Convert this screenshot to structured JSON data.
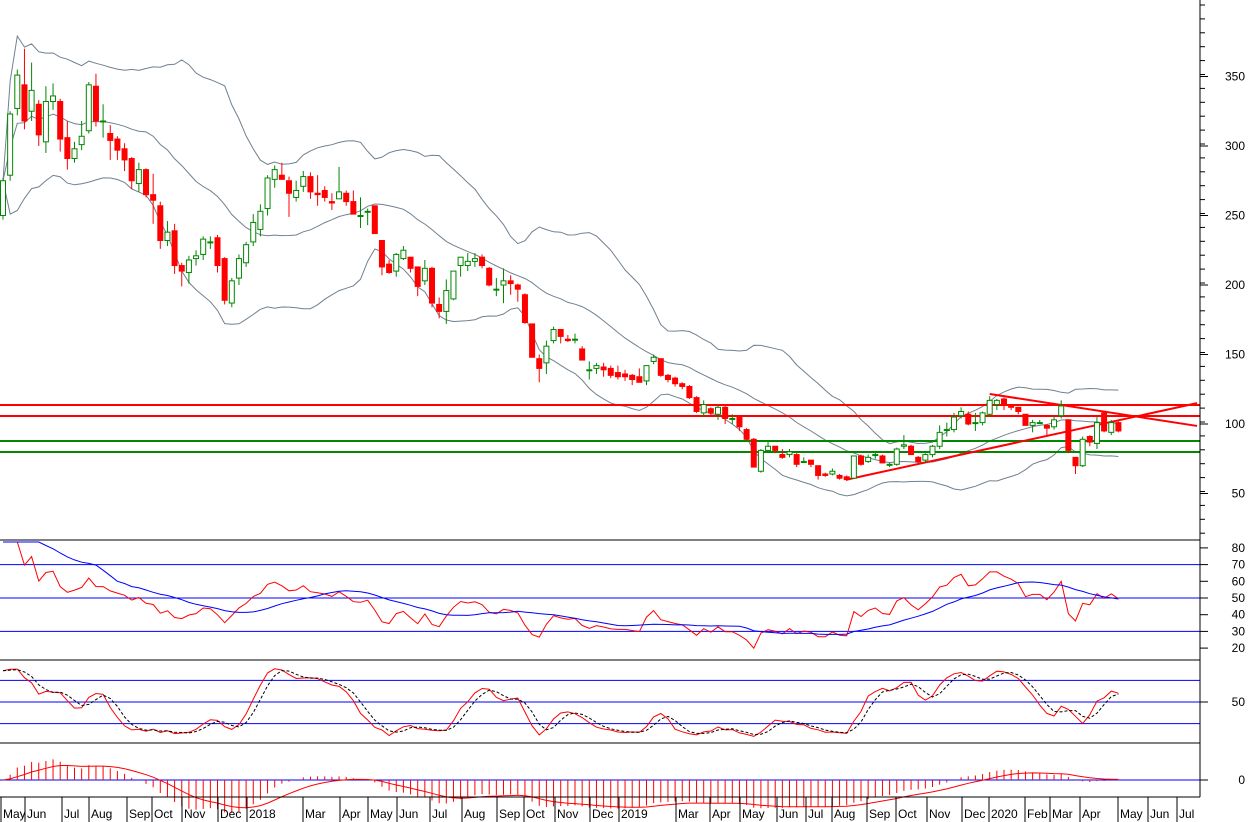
{
  "chart_data": {
    "type": "candlestick",
    "title": "",
    "colors": {
      "up": "#008800",
      "down": "#ff0000",
      "bands": "#708090",
      "rsi": "#ff0000",
      "rsi_ma": "#0000ff",
      "stoch_k": "#ff0000",
      "stoch_d": "#000000",
      "macd_hist": "#ff0000",
      "level_lines": "#0000ff",
      "resistance": "#ff0000",
      "support": "#008800"
    },
    "price_axis": {
      "ticks": [
        50,
        100,
        150,
        200,
        250,
        300,
        350
      ],
      "range": [
        20,
        400
      ]
    },
    "x_tick_labels": [
      "May",
      "Jun",
      "Jul",
      "Aug",
      "Sep",
      "Oct",
      "Nov",
      "Dec",
      "2018",
      "Mar",
      "Apr",
      "May",
      "Jun",
      "Jul",
      "Aug",
      "Sep",
      "Oct",
      "Nov",
      "Dec",
      "2019",
      "Mar",
      "Apr",
      "May",
      "Jun",
      "Jul",
      "Aug",
      "Sep",
      "Oct",
      "Nov",
      "Dec",
      "2020",
      "Feb",
      "Mar",
      "Apr",
      "May",
      "Jun",
      "Jul"
    ],
    "ohlc": [
      [
        250,
        277,
        247,
        275
      ],
      [
        279,
        325,
        275,
        323
      ],
      [
        327,
        355,
        322,
        351
      ],
      [
        344,
        370,
        312,
        318
      ],
      [
        325,
        360,
        318,
        340
      ],
      [
        330,
        333,
        300,
        308
      ],
      [
        303,
        343,
        295,
        332
      ],
      [
        332,
        345,
        326,
        336
      ],
      [
        332,
        334,
        296,
        305
      ],
      [
        306,
        318,
        283,
        291
      ],
      [
        291,
        303,
        288,
        298
      ],
      [
        301,
        318,
        297,
        307
      ],
      [
        311,
        346,
        309,
        344
      ],
      [
        343,
        352,
        314,
        318
      ],
      [
        318,
        330,
        306,
        318
      ],
      [
        309,
        315,
        290,
        304
      ],
      [
        305,
        307,
        290,
        297
      ],
      [
        298,
        302,
        282,
        290
      ],
      [
        291,
        292,
        269,
        275
      ],
      [
        273,
        288,
        267,
        283
      ],
      [
        283,
        284,
        263,
        265
      ],
      [
        265,
        280,
        244,
        261
      ],
      [
        257,
        260,
        226,
        232
      ],
      [
        232,
        246,
        228,
        238
      ],
      [
        239,
        244,
        208,
        214
      ],
      [
        214,
        216,
        199,
        210
      ],
      [
        209,
        221,
        201,
        218
      ],
      [
        219,
        225,
        214,
        221
      ],
      [
        222,
        235,
        218,
        233
      ],
      [
        231,
        235,
        226,
        231
      ],
      [
        234,
        236,
        209,
        214
      ],
      [
        219,
        220,
        186,
        189
      ],
      [
        187,
        205,
        184,
        203
      ],
      [
        205,
        222,
        200,
        219
      ],
      [
        216,
        231,
        213,
        229
      ],
      [
        231,
        251,
        228,
        245
      ],
      [
        240,
        258,
        235,
        253
      ],
      [
        255,
        279,
        250,
        277
      ],
      [
        276,
        286,
        270,
        283
      ],
      [
        279,
        288,
        276,
        276
      ],
      [
        275,
        278,
        249,
        266
      ],
      [
        263,
        275,
        260,
        268
      ],
      [
        271,
        282,
        267,
        278
      ],
      [
        278,
        281,
        262,
        267
      ],
      [
        266,
        279,
        257,
        265
      ],
      [
        268,
        271,
        260,
        263
      ],
      [
        260,
        266,
        254,
        259
      ],
      [
        262,
        285,
        262,
        267
      ],
      [
        266,
        268,
        257,
        260
      ],
      [
        260,
        268,
        251,
        251
      ],
      [
        250,
        263,
        241,
        250
      ],
      [
        253,
        255,
        243,
        253
      ],
      [
        257,
        257,
        237,
        237
      ],
      [
        232,
        232,
        207,
        213
      ],
      [
        215,
        218,
        208,
        209
      ],
      [
        210,
        223,
        206,
        222
      ],
      [
        219,
        228,
        218,
        225
      ],
      [
        220,
        220,
        209,
        212
      ],
      [
        213,
        213,
        192,
        199
      ],
      [
        203,
        218,
        200,
        212
      ],
      [
        212,
        213,
        184,
        187
      ],
      [
        186,
        191,
        176,
        181
      ],
      [
        181,
        204,
        172,
        196
      ],
      [
        190,
        210,
        189,
        210
      ],
      [
        214,
        220,
        206,
        220
      ],
      [
        214,
        223,
        210,
        217
      ],
      [
        217,
        223,
        213,
        219
      ],
      [
        220,
        222,
        212,
        214
      ],
      [
        212,
        213,
        199,
        200
      ],
      [
        197,
        205,
        192,
        197
      ],
      [
        200,
        212,
        187,
        203
      ],
      [
        203,
        207,
        193,
        201
      ],
      [
        200,
        201,
        188,
        197
      ],
      [
        193,
        194,
        172,
        173
      ],
      [
        172,
        172,
        148,
        148
      ],
      [
        147,
        150,
        130,
        140
      ],
      [
        144,
        160,
        136,
        156
      ],
      [
        160,
        170,
        158,
        168
      ],
      [
        168,
        168,
        158,
        163
      ],
      [
        161,
        164,
        159,
        160
      ],
      [
        161,
        165,
        158,
        161
      ],
      [
        154,
        156,
        146,
        146
      ],
      [
        139,
        145,
        132,
        139
      ],
      [
        140,
        144,
        136,
        142
      ],
      [
        141,
        144,
        134,
        139
      ],
      [
        140,
        142,
        133,
        135
      ],
      [
        137,
        142,
        132,
        134
      ],
      [
        136,
        139,
        131,
        134
      ],
      [
        135,
        136,
        128,
        132
      ],
      [
        134,
        140,
        130,
        130
      ],
      [
        131,
        142,
        128,
        142
      ],
      [
        145,
        150,
        143,
        148
      ],
      [
        147,
        147,
        134,
        135
      ],
      [
        135,
        136,
        130,
        132
      ],
      [
        133,
        134,
        127,
        129
      ],
      [
        129,
        130,
        125,
        127
      ],
      [
        127,
        128,
        118,
        119
      ],
      [
        119,
        120,
        108,
        109
      ],
      [
        108,
        117,
        105,
        114
      ],
      [
        111,
        112,
        106,
        108
      ],
      [
        107,
        113,
        103,
        112
      ],
      [
        112,
        114,
        100,
        104
      ],
      [
        104,
        107,
        100,
        104
      ],
      [
        105,
        106,
        95,
        98
      ],
      [
        96,
        97,
        88,
        89
      ],
      [
        89,
        90,
        69,
        69
      ],
      [
        66,
        82,
        65,
        81
      ],
      [
        81,
        87,
        80,
        84
      ],
      [
        84,
        84,
        79,
        81
      ],
      [
        78,
        82,
        75,
        76
      ],
      [
        78,
        82,
        76,
        80
      ],
      [
        78,
        79,
        69,
        71
      ],
      [
        73,
        76,
        72,
        73
      ],
      [
        74,
        74,
        69,
        71
      ],
      [
        70,
        70,
        60,
        63
      ],
      [
        64,
        65,
        62,
        63
      ],
      [
        64,
        68,
        63,
        66
      ],
      [
        63,
        64,
        60,
        61
      ],
      [
        62,
        63,
        59,
        60
      ],
      [
        61,
        77,
        61,
        77
      ],
      [
        77,
        78,
        70,
        71
      ],
      [
        73,
        78,
        72,
        76
      ],
      [
        78,
        80,
        75,
        78
      ],
      [
        77,
        78,
        72,
        72
      ],
      [
        71,
        72,
        69,
        71
      ],
      [
        71,
        83,
        70,
        82
      ],
      [
        84,
        92,
        82,
        85
      ],
      [
        84,
        85,
        78,
        78
      ],
      [
        76,
        77,
        72,
        73
      ],
      [
        74,
        79,
        72,
        78
      ],
      [
        78,
        85,
        76,
        84
      ],
      [
        84,
        99,
        82,
        94
      ],
      [
        96,
        101,
        91,
        96
      ],
      [
        96,
        108,
        94,
        105
      ],
      [
        106,
        112,
        104,
        109
      ],
      [
        107,
        109,
        99,
        100
      ],
      [
        101,
        108,
        95,
        101
      ],
      [
        101,
        109,
        99,
        108
      ],
      [
        107,
        120,
        105,
        117
      ],
      [
        114,
        118,
        110,
        117
      ],
      [
        118,
        119,
        110,
        114
      ],
      [
        113,
        114,
        110,
        112
      ],
      [
        112,
        112,
        107,
        109
      ],
      [
        107,
        107,
        99,
        99
      ],
      [
        99,
        103,
        94,
        101
      ],
      [
        101,
        103,
        100,
        101
      ],
      [
        99,
        100,
        92,
        97
      ],
      [
        98,
        106,
        96,
        103
      ],
      [
        106,
        117,
        104,
        113
      ],
      [
        103,
        103,
        79,
        81
      ],
      [
        76,
        76,
        64,
        70
      ],
      [
        70,
        91,
        69,
        89
      ],
      [
        91,
        92,
        84,
        87
      ],
      [
        86,
        105,
        82,
        101
      ],
      [
        108,
        109,
        94,
        95
      ],
      [
        94,
        103,
        92,
        101
      ],
      [
        101,
        102,
        94,
        95
      ]
    ],
    "horizontal_lines": [
      {
        "kind": "resistance",
        "price": 113.7
      },
      {
        "kind": "resistance",
        "price": 105.8
      },
      {
        "kind": "support",
        "price": 87.8
      },
      {
        "kind": "support",
        "price": 79.9
      }
    ],
    "trendlines": [
      {
        "from": {
          "candle": 118,
          "price": 60
        },
        "to": {
          "candle": 167,
          "price": 115
        }
      },
      {
        "from": {
          "candle": 138,
          "price": 121.6
        },
        "to": {
          "candle": 167,
          "price": 98.6
        }
      }
    ],
    "indicators": {
      "bollinger": {
        "period": 20,
        "stddev": 2
      },
      "rsi": {
        "period": 14,
        "ma_period": 14,
        "ticks": [
          80,
          70,
          60,
          50,
          40,
          30,
          20
        ],
        "levels": [
          70,
          50,
          30
        ]
      },
      "stochastic": {
        "k": 14,
        "smooth": 3,
        "d": 3,
        "ticks": [
          50
        ],
        "levels": [
          80,
          50,
          20
        ]
      },
      "macd": {
        "fast": 12,
        "slow": 26,
        "signal": 9,
        "ticks": [
          0
        ]
      }
    }
  }
}
